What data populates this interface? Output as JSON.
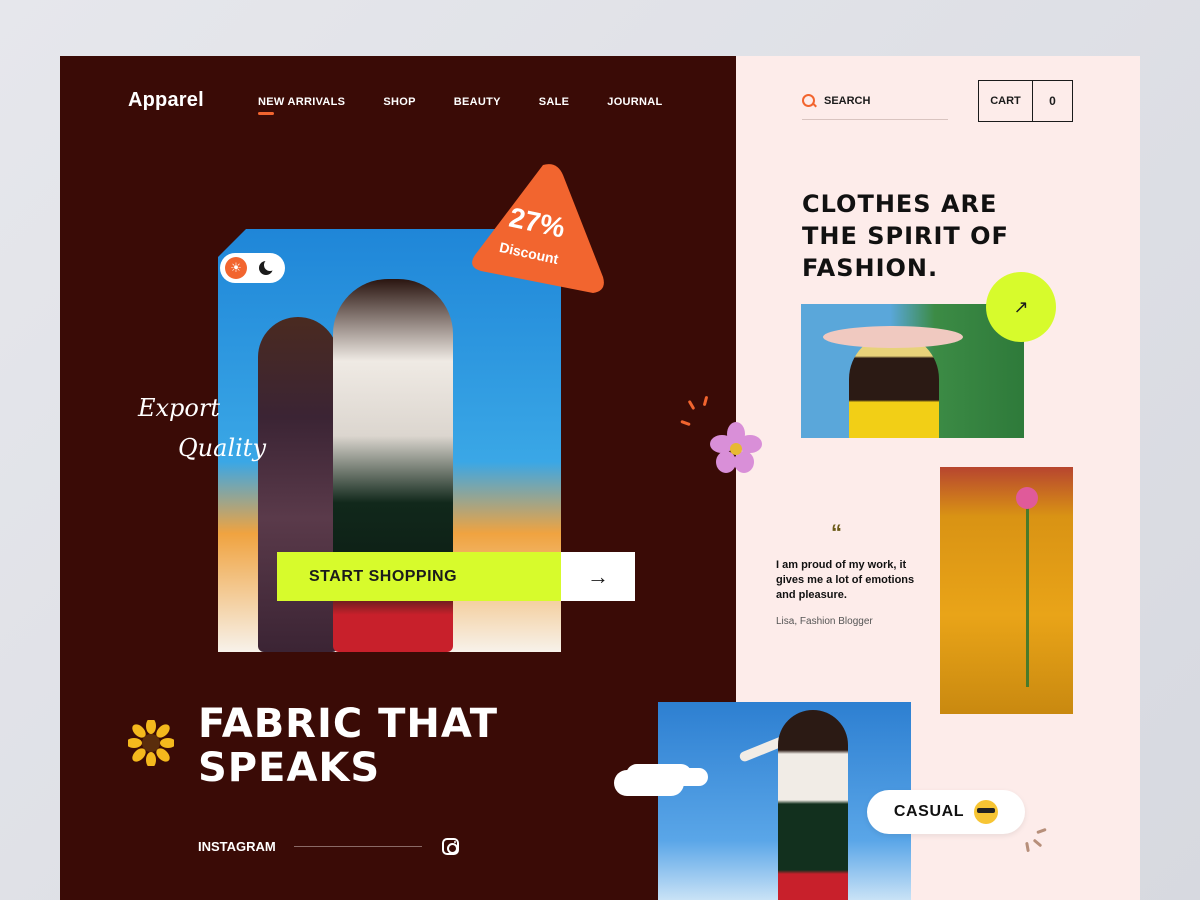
{
  "brand": {
    "logo": "Apparel"
  },
  "nav": {
    "items": [
      {
        "label": "NEW ARRIVALS",
        "active": true
      },
      {
        "label": "SHOP",
        "active": false
      },
      {
        "label": "BEAUTY",
        "active": false
      },
      {
        "label": "SALE",
        "active": false
      },
      {
        "label": "JOURNAL",
        "active": false
      }
    ]
  },
  "search": {
    "label": "SEARCH"
  },
  "cart": {
    "label": "CART",
    "count": "0"
  },
  "hero": {
    "discount_pct": "27%",
    "discount_label": "Discount",
    "script_line1": "Export",
    "script_line2": "Quality",
    "cta_label": "START SHOPPING",
    "cta_arrow": "→",
    "headline_line1": "FABRIC THAT",
    "headline_line2": "SPEAKS"
  },
  "social": {
    "label": "INSTAGRAM"
  },
  "right": {
    "tagline_line1": "CLOTHES ARE",
    "tagline_line2": "THE SPIRIT OF",
    "tagline_line3": "FASHION.",
    "badge_arrow": "↗",
    "quote_mark": "“",
    "quote_text": "I am proud of my work, it gives me a lot of emotions and pleasure.",
    "quote_author": "Lisa, Fashion Blogger",
    "casual_label": "CASUAL"
  },
  "colors": {
    "dark_maroon": "#3a0b06",
    "blush": "#fdecea",
    "accent_orange": "#f2652f",
    "lime": "#d7fb2c"
  },
  "icons": [
    "search-icon",
    "sun-icon",
    "moon-icon",
    "arrow-right-icon",
    "arrow-up-right-icon",
    "instagram-icon",
    "sunglasses-icon",
    "sunflower-icon",
    "flower-icon"
  ]
}
